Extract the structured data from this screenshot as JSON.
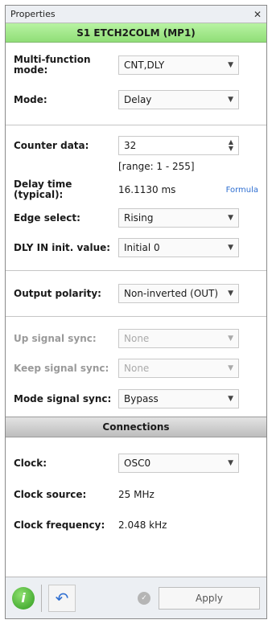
{
  "window": {
    "title": "Properties",
    "close_icon": "close-icon"
  },
  "header": {
    "title": "S1 ETCH2COLM (MP1)"
  },
  "function_block": {
    "multi_function_label": "Multi-function mode:",
    "multi_function_value": "CNT,DLY",
    "mode_label": "Mode:",
    "mode_value": "Delay"
  },
  "counter_block": {
    "counter_label": "Counter data:",
    "counter_value": "32",
    "range_text": "[range: 1 - 255]",
    "delay_label": "Delay time (typical):",
    "delay_value": "16.1130 ms",
    "delay_link": "Formula",
    "edge_label": "Edge select:",
    "edge_value": "Rising",
    "dly_label": "DLY IN init. value:",
    "dly_value": "Initial 0"
  },
  "output_block": {
    "polarity_label": "Output polarity:",
    "polarity_value": "Non-inverted (OUT)"
  },
  "sync_block": {
    "up_label": "Up signal sync:",
    "up_value": "None",
    "keep_label": "Keep signal sync:",
    "keep_value": "None",
    "mode_sync_label": "Mode signal sync:",
    "mode_sync_value": "Bypass"
  },
  "connections": {
    "title": "Connections",
    "clock_label": "Clock:",
    "clock_value": "OSC0",
    "source_label": "Clock source:",
    "source_value": "25 MHz",
    "freq_label": "Clock frequency:",
    "freq_value": "2.048 kHz"
  },
  "footer": {
    "apply_label": "Apply"
  }
}
